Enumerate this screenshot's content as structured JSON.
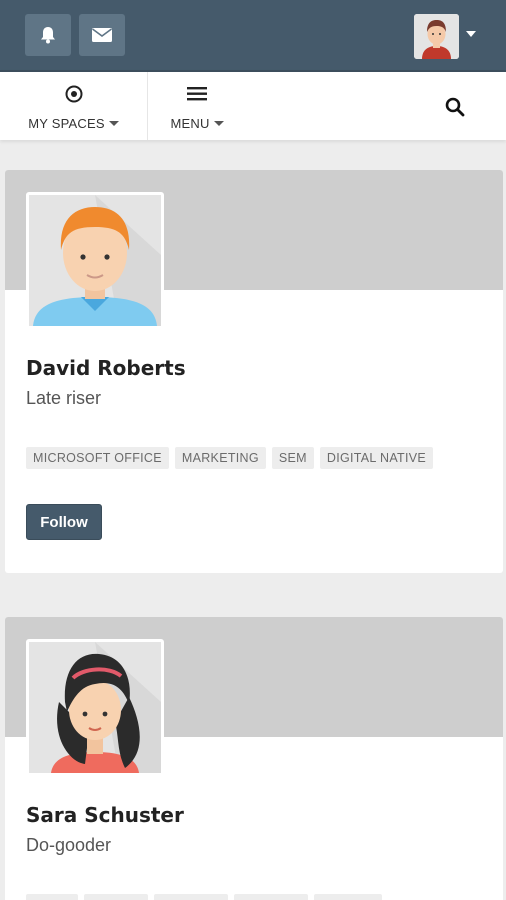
{
  "topbar": {
    "background": "#455a6b",
    "notifications_icon": "bell-icon",
    "messages_icon": "envelope-icon",
    "user_menu_icon": "caret-down-icon"
  },
  "nav": {
    "spaces_label": "MY SPACES",
    "menu_label": "MENU",
    "search_icon": "search-icon"
  },
  "profiles": [
    {
      "name": "David Roberts",
      "tagline": "Late riser",
      "tags": [
        "MICROSOFT OFFICE",
        "MARKETING",
        "SEM",
        "DIGITAL NATIVE"
      ],
      "follow_label": "Follow"
    },
    {
      "name": "Sara Schuster",
      "tagline": "Do-gooder"
    }
  ]
}
